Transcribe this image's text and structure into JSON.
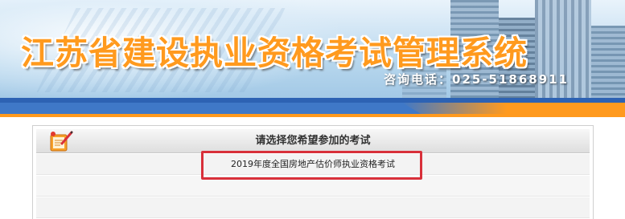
{
  "banner": {
    "title": "江苏省建设执业资格考试管理系统",
    "phone": "咨询电话：025-51868911"
  },
  "panel": {
    "icon": "notepad-pencil-icon",
    "title": "请选择您希望参加的考试",
    "exams": [
      {
        "label": "2019年度全国房地产估价师执业资格考试",
        "highlighted": true
      }
    ]
  },
  "colors": {
    "title_orange": "#ff9a1e",
    "bar_blue": "#2d62b3",
    "highlight_red": "#d8303a"
  }
}
